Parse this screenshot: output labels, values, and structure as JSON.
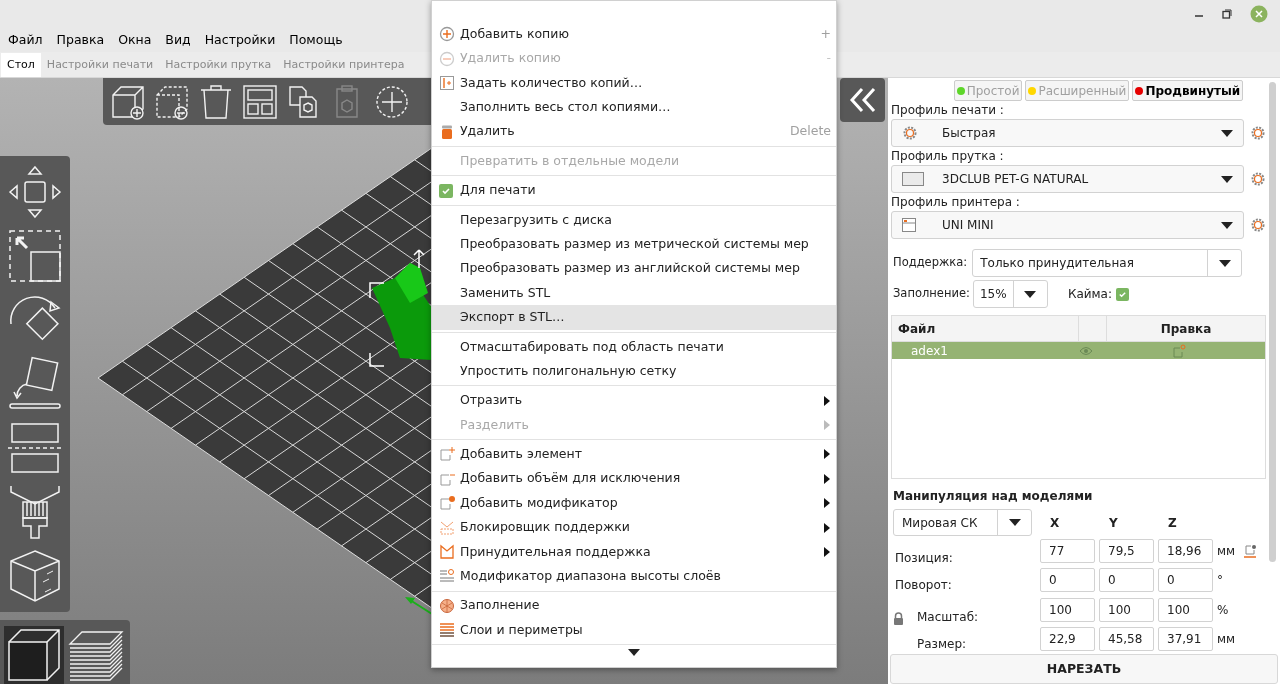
{
  "menu_bar": [
    "Файл",
    "Правка",
    "Окна",
    "Вид",
    "Настройки",
    "Помощь"
  ],
  "tabs": [
    {
      "label": "Стол",
      "selected": true
    },
    {
      "label": "Настройки печати",
      "selected": false
    },
    {
      "label": "Настройки прутка",
      "selected": false
    },
    {
      "label": "Настройки принтера",
      "selected": false
    }
  ],
  "context_menu": {
    "items": [
      {
        "kind": "item",
        "label": "Добавить копию",
        "shortcut": "+",
        "disabled": false,
        "selected": false,
        "submenu": false
      },
      {
        "kind": "item",
        "label": "Удалить копию",
        "shortcut": "-",
        "disabled": true,
        "selected": false,
        "submenu": false
      },
      {
        "kind": "item",
        "label": "Задать количество копий…",
        "disabled": false,
        "selected": false,
        "submenu": false
      },
      {
        "kind": "item",
        "label": "Заполнить весь стол копиями…",
        "disabled": false,
        "selected": false,
        "submenu": false
      },
      {
        "kind": "item",
        "label": "Удалить",
        "shortcut": "Delete",
        "disabled": false,
        "selected": false,
        "submenu": false
      },
      {
        "kind": "separator"
      },
      {
        "kind": "item",
        "label": "Превратить в отдельные модели",
        "disabled": true,
        "selected": false,
        "submenu": false
      },
      {
        "kind": "separator"
      },
      {
        "kind": "check",
        "label": "Для печати",
        "checked": true,
        "disabled": false,
        "selected": false,
        "submenu": false
      },
      {
        "kind": "separator"
      },
      {
        "kind": "item",
        "label": "Перезагрузить с диска",
        "disabled": false,
        "selected": false,
        "submenu": false
      },
      {
        "kind": "item",
        "label": "Преобразовать размер из метрической системы мер",
        "disabled": false,
        "selected": false,
        "submenu": false
      },
      {
        "kind": "item",
        "label": "Преобразовать размер из английской системы мер",
        "disabled": false,
        "selected": false,
        "submenu": false
      },
      {
        "kind": "item",
        "label": "Заменить STL",
        "disabled": false,
        "selected": false,
        "submenu": false
      },
      {
        "kind": "item",
        "label": "Экспорт в STL…",
        "disabled": false,
        "selected": true,
        "submenu": false
      },
      {
        "kind": "separator"
      },
      {
        "kind": "item",
        "label": "Отмасштабировать под область печати",
        "disabled": false,
        "selected": false,
        "submenu": false
      },
      {
        "kind": "item",
        "label": "Упростить полигональную сетку",
        "disabled": false,
        "selected": false,
        "submenu": false
      },
      {
        "kind": "separator"
      },
      {
        "kind": "item",
        "label": "Отразить",
        "disabled": false,
        "selected": false,
        "submenu": true
      },
      {
        "kind": "item",
        "label": "Разделить",
        "disabled": true,
        "selected": false,
        "submenu": true
      },
      {
        "kind": "separator"
      },
      {
        "kind": "item",
        "label": "Добавить элемент",
        "disabled": false,
        "selected": false,
        "submenu": true
      },
      {
        "kind": "item",
        "label": "Добавить объём для исключения",
        "disabled": false,
        "selected": false,
        "submenu": true
      },
      {
        "kind": "item",
        "label": "Добавить модификатор",
        "disabled": false,
        "selected": false,
        "submenu": true
      },
      {
        "kind": "item",
        "label": "Блокировщик поддержки",
        "disabled": false,
        "selected": false,
        "submenu": true
      },
      {
        "kind": "item",
        "label": "Принудительная поддержка",
        "disabled": false,
        "selected": false,
        "submenu": true
      },
      {
        "kind": "item",
        "label": "Модификатор диапазона высоты слоёв",
        "disabled": false,
        "selected": false,
        "submenu": false
      },
      {
        "kind": "separator"
      },
      {
        "kind": "item",
        "label": "Заполнение",
        "disabled": false,
        "selected": false,
        "submenu": false
      },
      {
        "kind": "item",
        "label": "Слои и периметры",
        "disabled": false,
        "selected": false,
        "submenu": false
      },
      {
        "kind": "separator"
      }
    ]
  },
  "mode_buttons": [
    {
      "label": "Простой",
      "color": "#5ed62a",
      "selected": false
    },
    {
      "label": "Расширенный",
      "color": "#ffd700",
      "selected": false
    },
    {
      "label": "Продвинутый",
      "color": "#e60000",
      "selected": true
    }
  ],
  "profiles": [
    {
      "label": "Профиль печати :",
      "value": "Быстрая"
    },
    {
      "label": "Профиль прутка :",
      "value": "3DCLUB PET-G NATURAL"
    },
    {
      "label": "Профиль принтера :",
      "value": "UNI MINI"
    }
  ],
  "support": {
    "label": "Поддержка:",
    "value": "Только принудительная"
  },
  "infill": {
    "label": "Заполнение:",
    "value": "15%"
  },
  "brim": {
    "label": "Кайма:",
    "checked": true
  },
  "object_list": {
    "columns": [
      "Файл",
      "Правка"
    ],
    "rows": [
      {
        "name": "adex1",
        "selected": true
      }
    ]
  },
  "manipulation": {
    "title": "Манипуляция над моделями",
    "coordinate_system": "Мировая СК",
    "axes": [
      "X",
      "Y",
      "Z"
    ],
    "rows": [
      {
        "label": "Позиция:",
        "values": [
          "77",
          "79,5",
          "18,96"
        ],
        "unit": "мм"
      },
      {
        "label": "Поворот:",
        "values": [
          "0",
          "0",
          "0"
        ],
        "unit": "°"
      },
      {
        "label": "Масштаб:",
        "values": [
          "100",
          "100",
          "100"
        ],
        "unit": "%"
      },
      {
        "label": "Размер:",
        "values": [
          "22,9",
          "45,58",
          "37,91"
        ],
        "unit": "мм"
      }
    ]
  },
  "slice_button": "НАРЕЗАТЬ"
}
